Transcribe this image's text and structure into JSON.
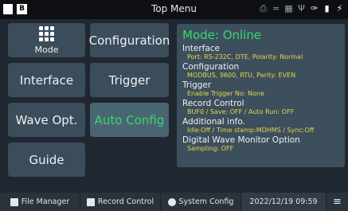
{
  "topbar": {
    "title": "Top Menu",
    "indicator_b": "B"
  },
  "menu": {
    "mode_label": "Mode",
    "configuration": "Configuration",
    "interface": "Interface",
    "trigger": "Trigger",
    "wave_opt": "Wave Opt.",
    "auto_config": "Auto Config",
    "guide": "Guide"
  },
  "panel": {
    "mode_title": "Mode: Online",
    "sections": [
      {
        "heading": "Interface",
        "value": "Port: RS-232C, DTE, Polarity: Normal"
      },
      {
        "heading": "Configuration",
        "value": "MODBUS, 9600, RTU, Parity: EVEN"
      },
      {
        "heading": "Trigger",
        "value": "Enable Trigger No: None"
      },
      {
        "heading": "Record Control",
        "value": "BUF0 / Save: OFF / Auto Run: OFF"
      },
      {
        "heading": "Additional info.",
        "value": "Idle:Off / Time stamp:MDHMS / Sync:Off"
      },
      {
        "heading": "Digital Wave Monitor Option",
        "value": "Sampling: OFF"
      }
    ]
  },
  "bottombar": {
    "file_manager": "File Manager",
    "record_control": "Record Control",
    "system_config": "System Config",
    "datetime": "2022/12/19 09:59"
  },
  "colors": {
    "online_green": "#39d86a",
    "value_yellow": "#e7d64a",
    "button_bg": "#3b4c5a",
    "active_button_bg": "#4a6572"
  }
}
